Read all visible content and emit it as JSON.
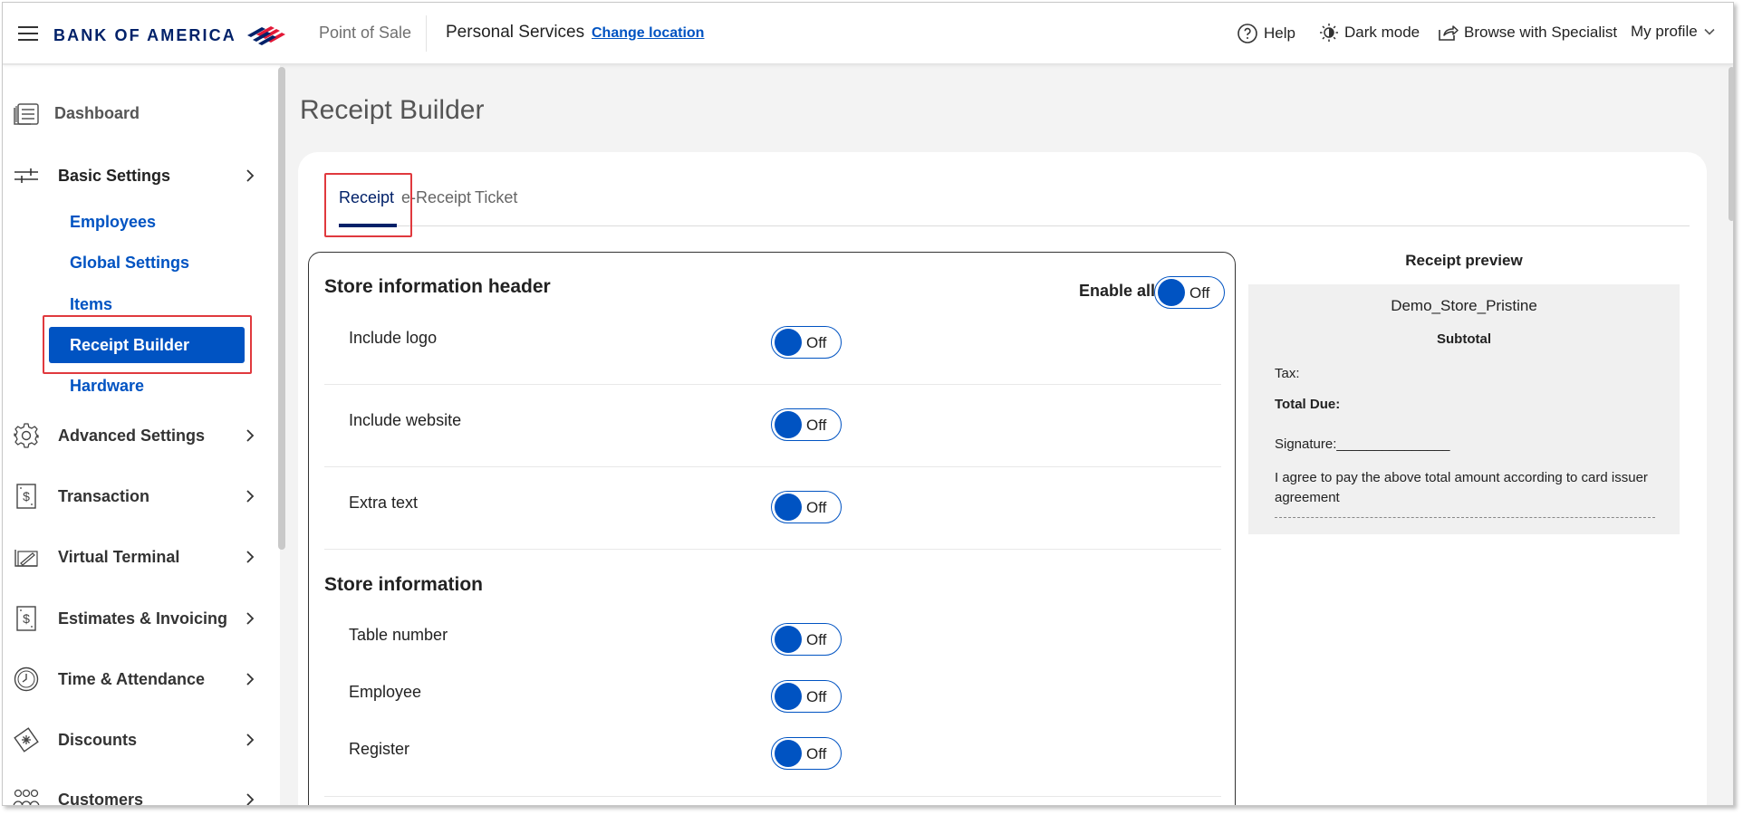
{
  "header": {
    "menu_icon": "hamburger-menu-icon",
    "brand": "BANK OF AMERICA",
    "app_name": "Point of Sale",
    "location": "Personal Services",
    "change_location": "Change location",
    "help": "Help",
    "dark_mode": "Dark mode",
    "browse": "Browse with Specialist",
    "profile": "My profile"
  },
  "sidebar": {
    "dashboard": "Dashboard",
    "basic_settings": "Basic Settings",
    "sub_items": [
      "Employees",
      "Global Settings",
      "Items",
      "Receipt Builder",
      "Hardware"
    ],
    "items": [
      "Advanced Settings",
      "Transaction",
      "Virtual Terminal",
      "Estimates & Invoicing",
      "Time & Attendance",
      "Discounts",
      "Customers"
    ]
  },
  "page": {
    "title": "Receipt Builder"
  },
  "tabs": [
    "Receipt",
    "e-Receipt",
    "Ticket"
  ],
  "settings": {
    "header_section": "Store information header",
    "enable_all": "Enable all",
    "enable_all_toggle": "Off",
    "header_rows": [
      {
        "label": "Include logo",
        "state": "Off"
      },
      {
        "label": "Include website",
        "state": "Off"
      },
      {
        "label": "Extra text",
        "state": "Off"
      }
    ],
    "info_section": "Store information",
    "info_rows": [
      {
        "label": "Table number",
        "state": "Off"
      },
      {
        "label": "Employee",
        "state": "Off"
      },
      {
        "label": "Register",
        "state": "Off"
      }
    ]
  },
  "preview": {
    "title": "Receipt preview",
    "store_name": "Demo_Store_Pristine",
    "subtotal": "Subtotal",
    "tax": "Tax:",
    "total_due": "Total Due:",
    "signature": "Signature:_______________",
    "agreement": "I agree to pay the above total amount according to card issuer agreement"
  },
  "colors": {
    "brand_navy": "#012169",
    "accent_blue": "#0053c2",
    "highlight_red": "#e0393e"
  }
}
